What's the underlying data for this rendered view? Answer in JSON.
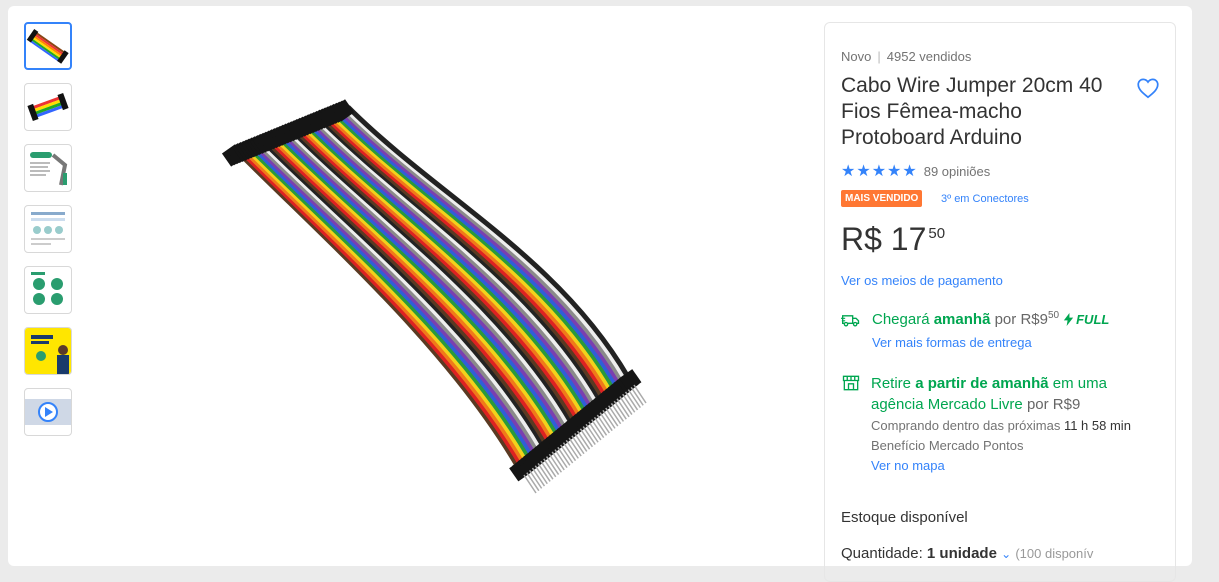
{
  "product": {
    "condition": "Novo",
    "separator": "|",
    "sold": "4952 vendidos",
    "title": "Cabo Wire Jumper 20cm 40 Fios Fêmea-macho Protoboard Arduino",
    "rating_stars": "★★★★★",
    "rating_value": 5,
    "opinions": "89 opiniões",
    "badge": "MAIS VENDIDO",
    "rank": "3º em Conectores",
    "price": {
      "currency": "R$",
      "integer": "17",
      "cents": "50"
    },
    "payment_link": "Ver os meios de pagamento"
  },
  "shipping": {
    "arrives": "Chegará",
    "when": "amanhã",
    "by": "por",
    "price_integer": "R$9",
    "price_cents": "50",
    "full_label": "FULL",
    "more_link": "Ver mais formas de entrega"
  },
  "pickup": {
    "text1": "Retire",
    "text2": "a partir de amanhã",
    "text3": "em uma agência Mercado Livre",
    "by": "por",
    "price": "R$9",
    "buying_within": "Comprando dentro das próximas",
    "time_left": "11 h 58 min",
    "benefit": "Benefício Mercado Pontos",
    "map_link": "Ver no mapa"
  },
  "stock": {
    "label": "Estoque disponível",
    "quantity_label": "Quantidade:",
    "quantity_value": "1 unidade",
    "available": "(100 disponív"
  },
  "thumbnails": [
    "wire-jumper-photo",
    "wire-jumper-bundle",
    "product-info-sheet",
    "product-diagram",
    "product-features",
    "promo-banner",
    "product-video"
  ],
  "colors": {
    "accent": "#3483fa",
    "green": "#00a650",
    "badge": "#ff7733"
  }
}
